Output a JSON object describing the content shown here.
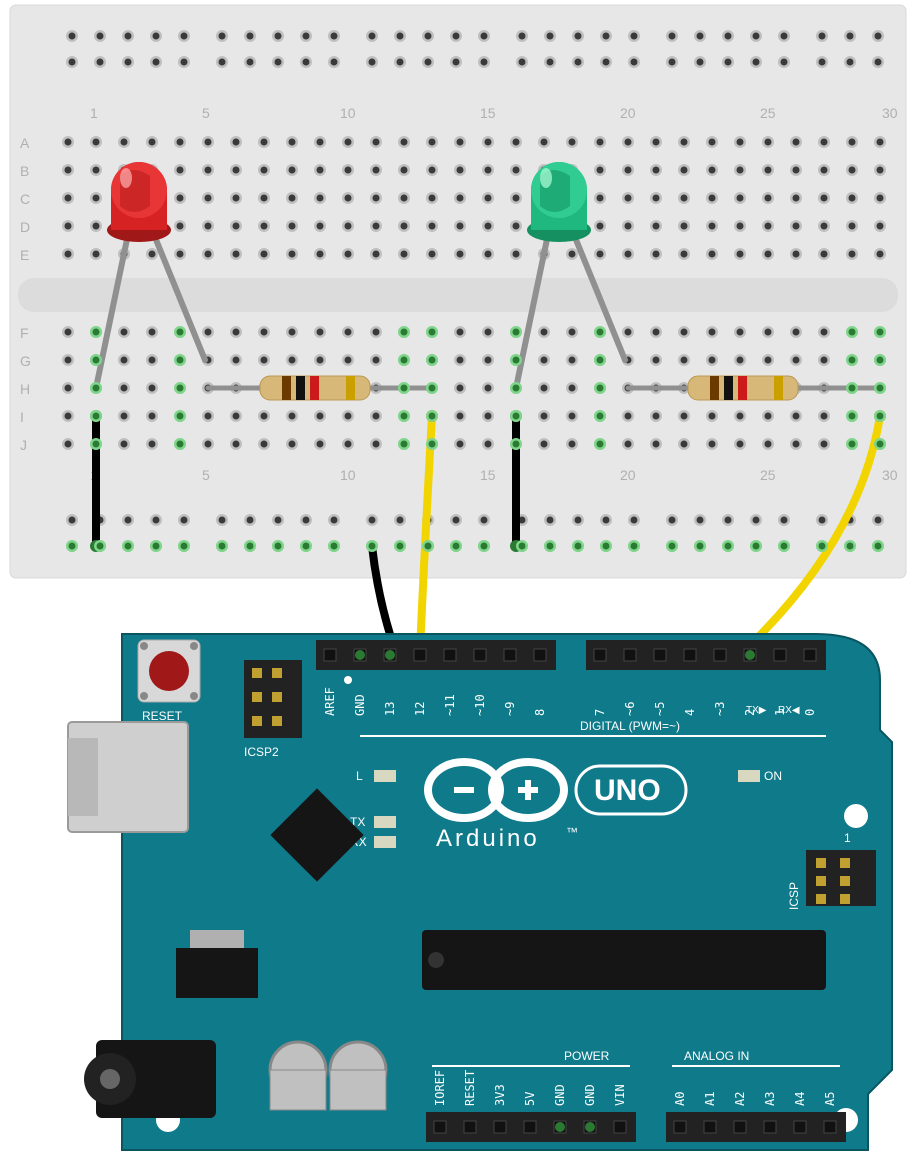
{
  "breadboard": {
    "row_labels": [
      "A",
      "B",
      "C",
      "D",
      "E",
      "F",
      "G",
      "H",
      "I",
      "J"
    ],
    "col_labels": [
      "1",
      "5",
      "10",
      "15",
      "20",
      "25",
      "30"
    ],
    "col_positions": [
      1,
      5,
      10,
      15,
      20,
      25,
      30
    ]
  },
  "components": {
    "led_red": {
      "type": "LED",
      "color": "#d32020",
      "anode_col": 2,
      "cathode_col": 5
    },
    "led_green": {
      "type": "LED",
      "color": "#1fb980",
      "anode_col": 17,
      "cathode_col": 20
    },
    "resistor1": {
      "from_col": 5,
      "to_col": 13,
      "from_row": "H",
      "to_row": "H",
      "bands": [
        "#6b3a00",
        "#000",
        "#d12",
        "#c9a000"
      ]
    },
    "resistor2": {
      "from_col": 20,
      "to_col": 30,
      "from_row": "H",
      "to_row": "H",
      "bands": [
        "#6b3a00",
        "#000",
        "#d12",
        "#c9a000"
      ]
    }
  },
  "wires": [
    {
      "name": "gnd-jumper-red-led",
      "color": "#000",
      "from": "I2",
      "to": "rail-"
    },
    {
      "name": "gnd-jumper-green-led",
      "color": "#000",
      "from": "I17",
      "to": "rail-"
    },
    {
      "name": "gnd-to-arduino",
      "color": "#000",
      "from": "rail-",
      "to": "GND"
    },
    {
      "name": "signal-red-led",
      "color": "#f7e400",
      "from": "I13",
      "to": "D13"
    },
    {
      "name": "signal-green-led",
      "color": "#f7e400",
      "from": "I30",
      "to": "D2"
    }
  ],
  "arduino": {
    "model": "UNO",
    "brand": "Arduino",
    "tm": "™",
    "reset_label": "RESET",
    "icsp2_label": "ICSP2",
    "icsp_label": "ICSP",
    "icsp_one": "1",
    "led_l": "L",
    "led_tx": "TX",
    "led_rx": "RX",
    "led_on": "ON",
    "digital_label": "DIGITAL (PWM=~)",
    "tx_arrow": "TX▶",
    "rx_arrow": "RX◀",
    "pins_top_left": [
      "AREF",
      "GND",
      "13",
      "12",
      "~11",
      "~10",
      "~9",
      "8"
    ],
    "pins_top_right": [
      "7",
      "~6",
      "~5",
      "4",
      "~3",
      "2",
      "1",
      "0"
    ],
    "power_label": "POWER",
    "analog_label": "ANALOG IN",
    "pins_bottom_left": [
      "IOREF",
      "RESET",
      "3V3",
      "5V",
      "GND",
      "GND",
      "VIN"
    ],
    "pins_bottom_right": [
      "A0",
      "A1",
      "A2",
      "A3",
      "A4",
      "A5"
    ]
  }
}
